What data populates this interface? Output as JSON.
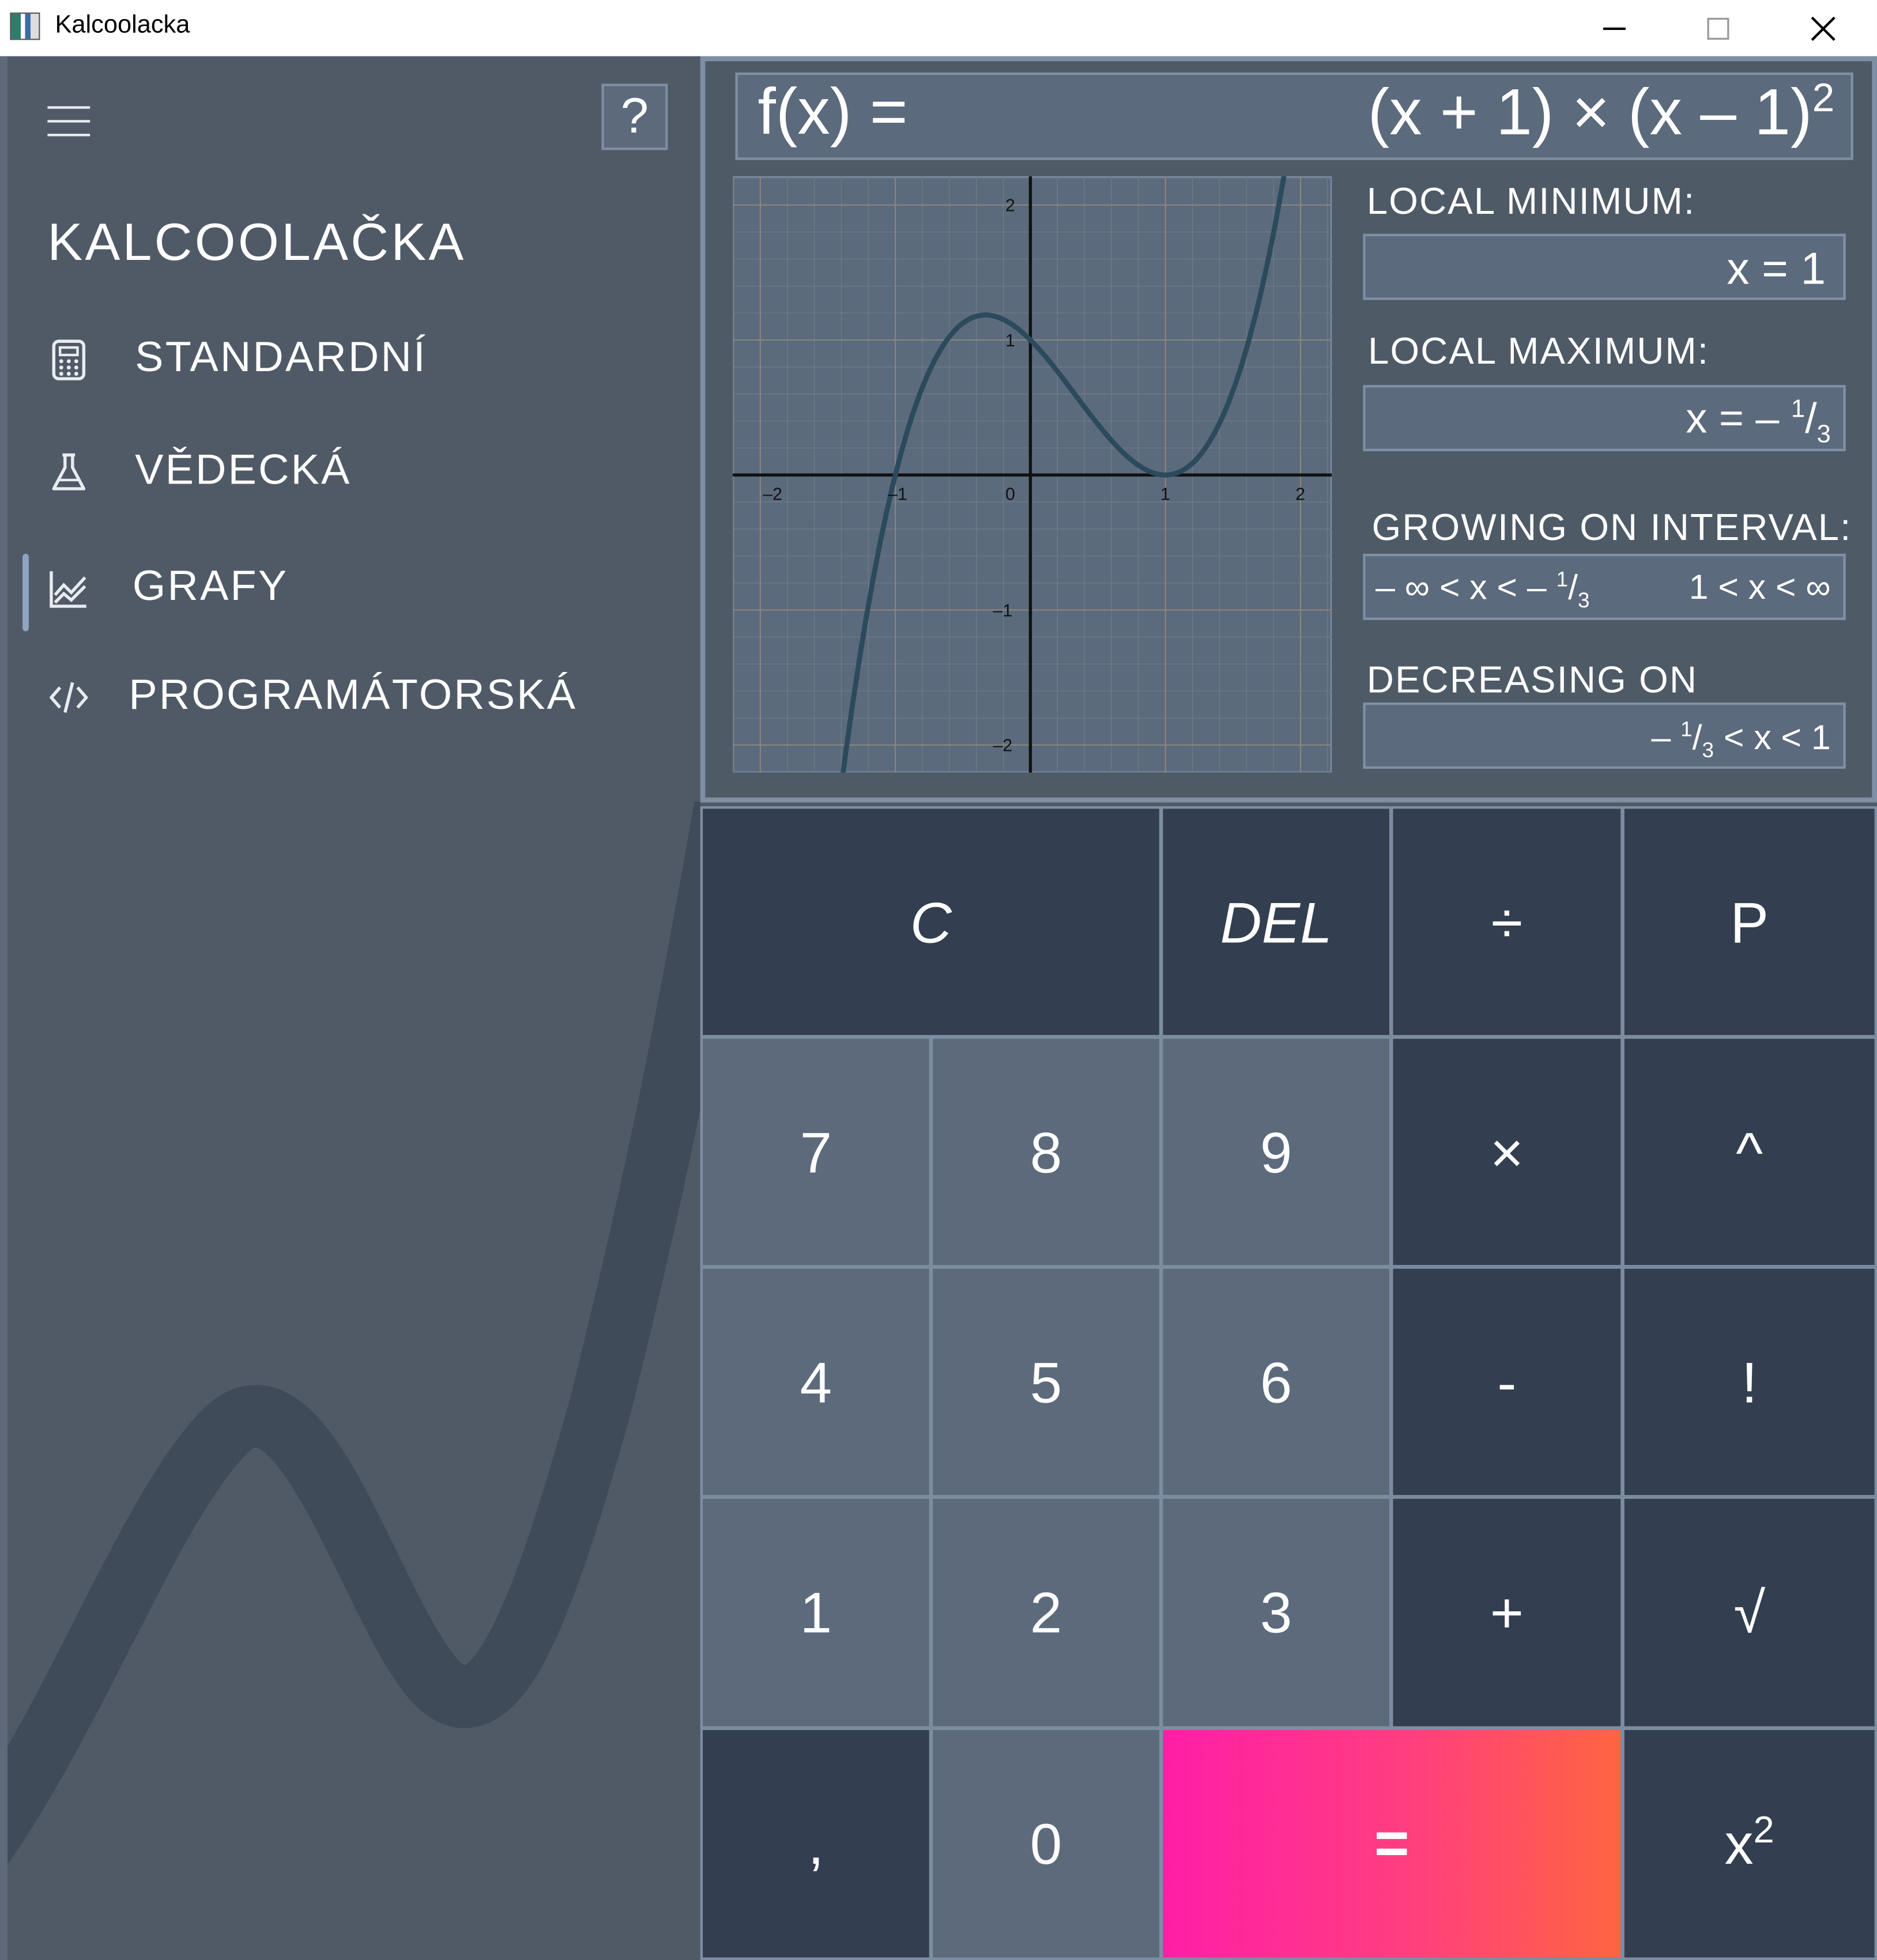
{
  "window": {
    "title": "Kalcoolacka"
  },
  "sidebar": {
    "heading": "KALCOOLAČKA",
    "help_label": "?",
    "items": [
      {
        "label": "STANDARDNÍ",
        "icon": "calculator-icon"
      },
      {
        "label": "VĚDECKÁ",
        "icon": "flask-icon"
      },
      {
        "label": "GRAFY",
        "icon": "chart-icon",
        "active": true
      },
      {
        "label": "PROGRAMÁTORSKÁ",
        "icon": "code-icon"
      }
    ]
  },
  "function": {
    "label": "f(x) =",
    "expression_base": "(x + 1) × (x – 1)",
    "expression_exp": "2"
  },
  "graph": {
    "x_ticks": [
      "–2",
      "–1",
      "0",
      "1",
      "2"
    ],
    "y_ticks": [
      "2",
      "1",
      "–1",
      "–2"
    ],
    "curve_color": "#2b4a5c"
  },
  "analysis": {
    "local_minimum": {
      "label": "LOCAL MINIMUM:",
      "value": "x = 1"
    },
    "local_maximum": {
      "label": "LOCAL MAXIMUM:",
      "prefix": "x = –",
      "num": "1",
      "den": "3"
    },
    "growing": {
      "label": "GROWING ON INTERVAL:",
      "left_prefix": "– ∞ < x < –",
      "left_num": "1",
      "left_den": "3",
      "right": "1 < x < ∞"
    },
    "decreasing": {
      "label": "DECREASING ON INTERVAL:",
      "prefix": "–",
      "num": "1",
      "den": "3",
      "suffix": "< x < 1"
    }
  },
  "keys": {
    "clear": "C",
    "del": "DEL",
    "divide": "÷",
    "p": "P",
    "seven": "7",
    "eight": "8",
    "nine": "9",
    "multiply": "×",
    "power": "^",
    "four": "4",
    "five": "5",
    "six": "6",
    "minus": "-",
    "factorial": "!",
    "one": "1",
    "two": "2",
    "three": "3",
    "plus": "+",
    "sqrt": "√",
    "comma": ",",
    "zero": "0",
    "equals": "=",
    "square_base": "x",
    "square_exp": "2"
  },
  "colors": {
    "accent_start": "#ff1ea8",
    "accent_end": "#ff6540",
    "dark_key": "#333f50",
    "light_key": "#5c6a7c"
  }
}
